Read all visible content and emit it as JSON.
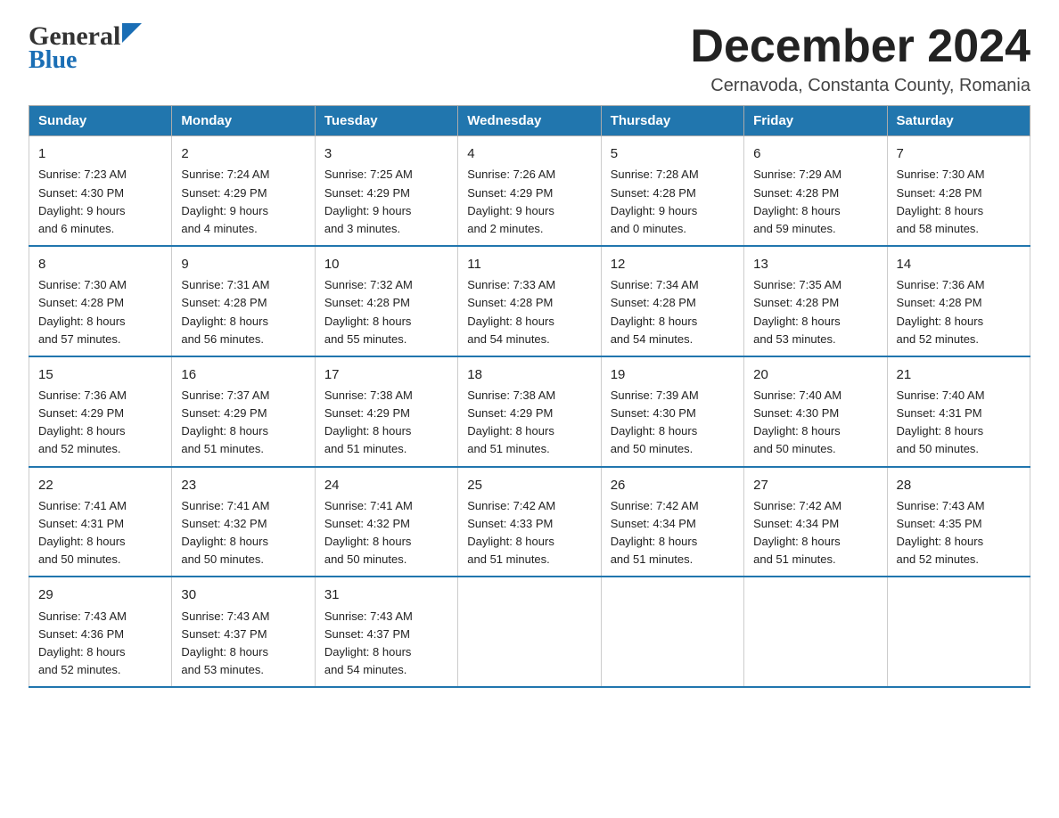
{
  "header": {
    "logo_text1": "General",
    "logo_text2": "Blue",
    "month_year": "December 2024",
    "location": "Cernavoda, Constanta County, Romania"
  },
  "weekdays": [
    "Sunday",
    "Monday",
    "Tuesday",
    "Wednesday",
    "Thursday",
    "Friday",
    "Saturday"
  ],
  "weeks": [
    [
      {
        "day": "1",
        "sunrise": "7:23 AM",
        "sunset": "4:30 PM",
        "daylight": "9 hours and 6 minutes."
      },
      {
        "day": "2",
        "sunrise": "7:24 AM",
        "sunset": "4:29 PM",
        "daylight": "9 hours and 4 minutes."
      },
      {
        "day": "3",
        "sunrise": "7:25 AM",
        "sunset": "4:29 PM",
        "daylight": "9 hours and 3 minutes."
      },
      {
        "day": "4",
        "sunrise": "7:26 AM",
        "sunset": "4:29 PM",
        "daylight": "9 hours and 2 minutes."
      },
      {
        "day": "5",
        "sunrise": "7:28 AM",
        "sunset": "4:28 PM",
        "daylight": "9 hours and 0 minutes."
      },
      {
        "day": "6",
        "sunrise": "7:29 AM",
        "sunset": "4:28 PM",
        "daylight": "8 hours and 59 minutes."
      },
      {
        "day": "7",
        "sunrise": "7:30 AM",
        "sunset": "4:28 PM",
        "daylight": "8 hours and 58 minutes."
      }
    ],
    [
      {
        "day": "8",
        "sunrise": "7:30 AM",
        "sunset": "4:28 PM",
        "daylight": "8 hours and 57 minutes."
      },
      {
        "day": "9",
        "sunrise": "7:31 AM",
        "sunset": "4:28 PM",
        "daylight": "8 hours and 56 minutes."
      },
      {
        "day": "10",
        "sunrise": "7:32 AM",
        "sunset": "4:28 PM",
        "daylight": "8 hours and 55 minutes."
      },
      {
        "day": "11",
        "sunrise": "7:33 AM",
        "sunset": "4:28 PM",
        "daylight": "8 hours and 54 minutes."
      },
      {
        "day": "12",
        "sunrise": "7:34 AM",
        "sunset": "4:28 PM",
        "daylight": "8 hours and 54 minutes."
      },
      {
        "day": "13",
        "sunrise": "7:35 AM",
        "sunset": "4:28 PM",
        "daylight": "8 hours and 53 minutes."
      },
      {
        "day": "14",
        "sunrise": "7:36 AM",
        "sunset": "4:28 PM",
        "daylight": "8 hours and 52 minutes."
      }
    ],
    [
      {
        "day": "15",
        "sunrise": "7:36 AM",
        "sunset": "4:29 PM",
        "daylight": "8 hours and 52 minutes."
      },
      {
        "day": "16",
        "sunrise": "7:37 AM",
        "sunset": "4:29 PM",
        "daylight": "8 hours and 51 minutes."
      },
      {
        "day": "17",
        "sunrise": "7:38 AM",
        "sunset": "4:29 PM",
        "daylight": "8 hours and 51 minutes."
      },
      {
        "day": "18",
        "sunrise": "7:38 AM",
        "sunset": "4:29 PM",
        "daylight": "8 hours and 51 minutes."
      },
      {
        "day": "19",
        "sunrise": "7:39 AM",
        "sunset": "4:30 PM",
        "daylight": "8 hours and 50 minutes."
      },
      {
        "day": "20",
        "sunrise": "7:40 AM",
        "sunset": "4:30 PM",
        "daylight": "8 hours and 50 minutes."
      },
      {
        "day": "21",
        "sunrise": "7:40 AM",
        "sunset": "4:31 PM",
        "daylight": "8 hours and 50 minutes."
      }
    ],
    [
      {
        "day": "22",
        "sunrise": "7:41 AM",
        "sunset": "4:31 PM",
        "daylight": "8 hours and 50 minutes."
      },
      {
        "day": "23",
        "sunrise": "7:41 AM",
        "sunset": "4:32 PM",
        "daylight": "8 hours and 50 minutes."
      },
      {
        "day": "24",
        "sunrise": "7:41 AM",
        "sunset": "4:32 PM",
        "daylight": "8 hours and 50 minutes."
      },
      {
        "day": "25",
        "sunrise": "7:42 AM",
        "sunset": "4:33 PM",
        "daylight": "8 hours and 51 minutes."
      },
      {
        "day": "26",
        "sunrise": "7:42 AM",
        "sunset": "4:34 PM",
        "daylight": "8 hours and 51 minutes."
      },
      {
        "day": "27",
        "sunrise": "7:42 AM",
        "sunset": "4:34 PM",
        "daylight": "8 hours and 51 minutes."
      },
      {
        "day": "28",
        "sunrise": "7:43 AM",
        "sunset": "4:35 PM",
        "daylight": "8 hours and 52 minutes."
      }
    ],
    [
      {
        "day": "29",
        "sunrise": "7:43 AM",
        "sunset": "4:36 PM",
        "daylight": "8 hours and 52 minutes."
      },
      {
        "day": "30",
        "sunrise": "7:43 AM",
        "sunset": "4:37 PM",
        "daylight": "8 hours and 53 minutes."
      },
      {
        "day": "31",
        "sunrise": "7:43 AM",
        "sunset": "4:37 PM",
        "daylight": "8 hours and 54 minutes."
      },
      null,
      null,
      null,
      null
    ]
  ],
  "labels": {
    "sunrise": "Sunrise:",
    "sunset": "Sunset:",
    "daylight": "Daylight:"
  }
}
